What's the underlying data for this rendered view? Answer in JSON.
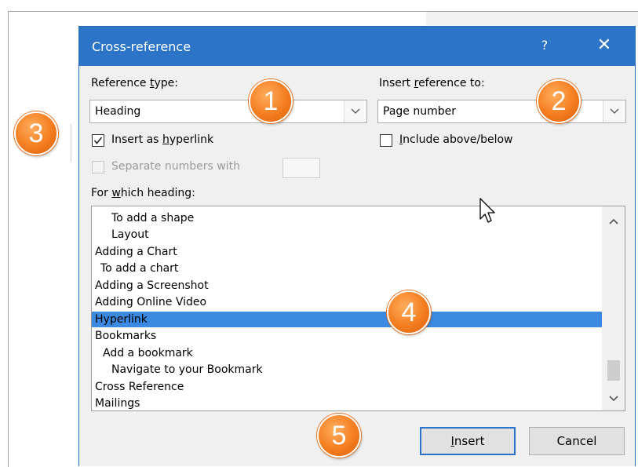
{
  "dialog": {
    "title": "Cross-reference",
    "help_label": "?",
    "close_label": "✕"
  },
  "reference_type": {
    "label_before": "Reference ",
    "label_underline": "t",
    "label_after": "ype:",
    "value": "Heading"
  },
  "insert_reference_to": {
    "label_before": "Insert ",
    "label_underline": "r",
    "label_after": "eference to:",
    "value": "Page number"
  },
  "insert_as_hyperlink": {
    "label_before": "Insert as ",
    "label_underline": "h",
    "label_after": "yperlink",
    "checked": true
  },
  "include_above_below": {
    "label_before": "",
    "label_underline": "I",
    "label_after": "nclude above/below",
    "checked": false
  },
  "separate_numbers": {
    "label": "Separate numbers with",
    "checked": false,
    "value": ""
  },
  "heading_list": {
    "label_before": "For ",
    "label_underline": "w",
    "label_after": "hich heading:",
    "items": [
      "To add a shape",
      "Layout",
      "Adding a Chart",
      "To add a chart",
      "Adding a Screenshot",
      "Adding Online Video",
      "Hyperlink",
      "Bookmarks",
      "Add a bookmark",
      "Navigate to your Bookmark",
      "Cross Reference",
      "Mailings"
    ],
    "selected": "Hyperlink"
  },
  "buttons": {
    "insert_underline": "I",
    "insert_after": "nsert",
    "cancel": "Cancel"
  },
  "callouts": [
    "1",
    "2",
    "3",
    "4",
    "5"
  ],
  "colors": {
    "titlebar": "#2b74c8",
    "selection": "#3b89e0",
    "callout": "#f47d20"
  }
}
